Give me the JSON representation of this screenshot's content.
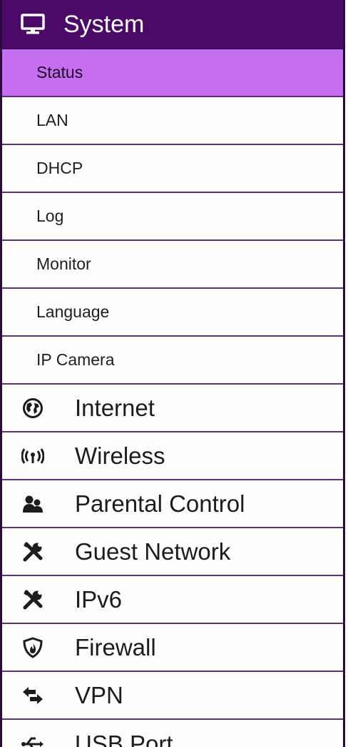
{
  "menu": {
    "header": {
      "label": "System",
      "icon": "monitor-icon"
    },
    "system_items": [
      {
        "label": "Status",
        "active": true
      },
      {
        "label": "LAN"
      },
      {
        "label": "DHCP"
      },
      {
        "label": "Log"
      },
      {
        "label": "Monitor"
      },
      {
        "label": "Language"
      },
      {
        "label": "IP Camera"
      }
    ],
    "top_items": [
      {
        "label": "Internet",
        "icon": "globe-icon"
      },
      {
        "label": "Wireless",
        "icon": "wireless-icon"
      },
      {
        "label": "Parental Control",
        "icon": "users-icon"
      },
      {
        "label": "Guest Network",
        "icon": "tools-icon"
      },
      {
        "label": "IPv6",
        "icon": "tools-icon"
      },
      {
        "label": "Firewall",
        "icon": "shield-icon"
      },
      {
        "label": "VPN",
        "icon": "exchange-icon"
      },
      {
        "label": "USB Port",
        "icon": "usb-icon"
      }
    ]
  },
  "colors": {
    "header_bg": "#4b0a67",
    "active_bg": "#c66ef0",
    "divider": "#5e3274"
  }
}
